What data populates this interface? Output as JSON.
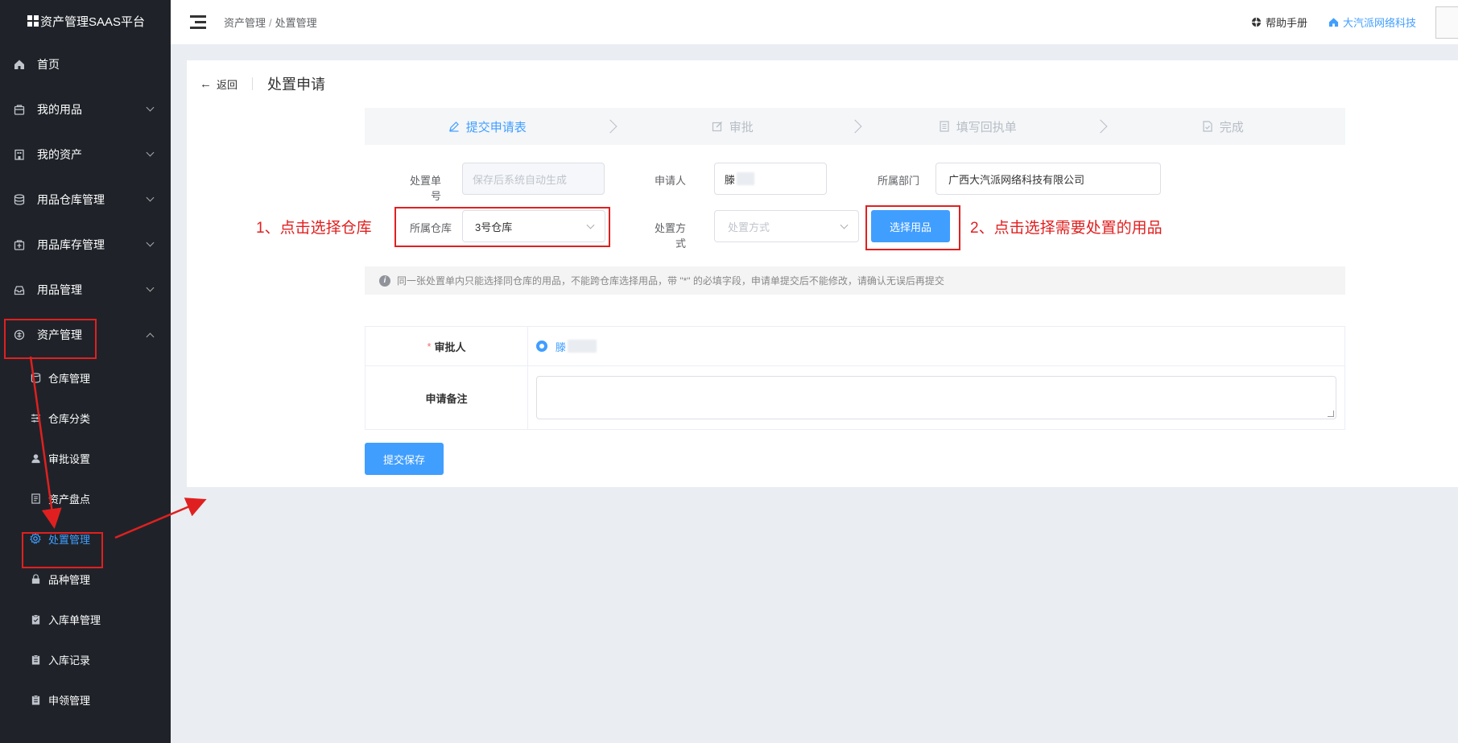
{
  "app": {
    "title": "资产管理SAAS平台"
  },
  "header": {
    "breadcrumb": [
      "资产管理",
      "处置管理"
    ],
    "breadcrumb_sep": "/",
    "help_label": "帮助手册",
    "company_label": "大汽派网络科技"
  },
  "sidebar": {
    "items": [
      {
        "label": "首页",
        "icon": "home-icon",
        "expandable": false
      },
      {
        "label": "我的用品",
        "icon": "bag-icon",
        "expandable": true
      },
      {
        "label": "我的资产",
        "icon": "building-icon",
        "expandable": true
      },
      {
        "label": "用品仓库管理",
        "icon": "database-icon",
        "expandable": true
      },
      {
        "label": "用品库存管理",
        "icon": "bag-icon",
        "expandable": true
      },
      {
        "label": "用品管理",
        "icon": "inbox-icon",
        "expandable": true
      },
      {
        "label": "资产管理",
        "icon": "asset-icon",
        "expandable": true,
        "expanded": true
      }
    ],
    "sub_items": [
      {
        "label": "仓库管理",
        "icon": "database-icon"
      },
      {
        "label": "仓库分类",
        "icon": "sliders-icon"
      },
      {
        "label": "审批设置",
        "icon": "user-icon"
      },
      {
        "label": "资产盘点",
        "icon": "document-icon"
      },
      {
        "label": "处置管理",
        "icon": "gear-icon",
        "active": true
      },
      {
        "label": "品种管理",
        "icon": "lock-icon"
      },
      {
        "label": "入库单管理",
        "icon": "clipboard-icon"
      },
      {
        "label": "入库记录",
        "icon": "clipboard-icon"
      },
      {
        "label": "申领管理",
        "icon": "clipboard-icon"
      }
    ]
  },
  "page": {
    "back_label": "返回",
    "title": "处置申请",
    "steps": [
      {
        "label": "提交申请表",
        "active": true
      },
      {
        "label": "审批",
        "active": false
      },
      {
        "label": "填写回执单",
        "active": false
      },
      {
        "label": "完成",
        "active": false
      }
    ],
    "form": {
      "order_no_label": "处置单号",
      "order_no_placeholder": "保存后系统自动生成",
      "applicant_label": "申请人",
      "applicant_value": "滕",
      "dept_label": "所属部门",
      "dept_value": "广西大汽派网络科技有限公司",
      "warehouse_label": "所属仓库",
      "warehouse_value": "3号仓库",
      "method_label": "处置方式",
      "method_placeholder": "处置方式",
      "select_btn": "选择用品"
    },
    "notice": "同一张处置单内只能选择同仓库的用品，不能跨仓库选择用品，带 \"*\" 的必填字段，申请单提交后不能修改，请确认无误后再提交",
    "approver_label": "审批人",
    "approver_required_mark": "*",
    "approver_value": "滕",
    "remark_label": "申请备注",
    "submit_btn": "提交保存"
  },
  "annotations": {
    "step1": "1、点击选择仓库",
    "step2": "2、点击选择需要处置的用品"
  },
  "colors": {
    "accent": "#409eff",
    "sidebar_bg": "#1f2329",
    "highlight": "#e02020"
  }
}
